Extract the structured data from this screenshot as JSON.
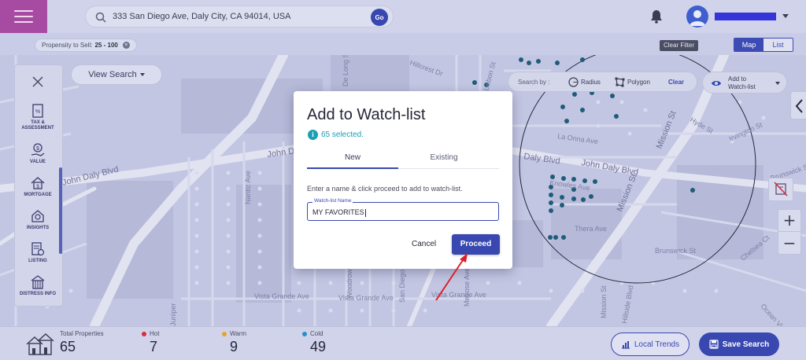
{
  "topbar": {
    "search_value": "333 San Diego Ave, Daly City, CA 94014, USA",
    "go_label": "Go"
  },
  "filters": {
    "chip_label": "Propensity to Sell:",
    "chip_value": "25 - 100",
    "clear_filter": "Clear Filter",
    "view_map": "Map",
    "view_list": "List"
  },
  "sidebar": {
    "items": [
      {
        "label": "TAX &\nASSESSMENT",
        "icon": "tax-assessment-icon"
      },
      {
        "label": "VALUE",
        "icon": "value-icon"
      },
      {
        "label": "MORTGAGE",
        "icon": "mortgage-icon"
      },
      {
        "label": "INSIGHTS",
        "icon": "insights-icon"
      },
      {
        "label": "LISTING",
        "icon": "listing-icon"
      },
      {
        "label": "DISTRESS INFO",
        "icon": "distress-info-icon"
      }
    ]
  },
  "view_search_label": "View Search",
  "searchby": {
    "label": "Search by :",
    "radius": "Radius",
    "polygon": "Polygon",
    "clear": "Clear"
  },
  "watchlist_button": {
    "line1": "Add to",
    "line2": "Watch-list"
  },
  "map": {
    "streets": [
      "John Daly Blvd",
      "John Daly Blvd",
      "Daly Blvd",
      "John Daly Blvd",
      "Mission St",
      "Mission St",
      "Vista Grande Ave",
      "Vista Grande Ave",
      "Vista Grande Ave",
      "Hillcrest Dr",
      "De Long St",
      "Lisbon St",
      "Lisbon St",
      "Knowles Ave",
      "Thera Ave",
      "La Onna Ave",
      "Brunswick St",
      "Brunswick St",
      "Chelsea Ct",
      "Ocean View Ct",
      "Hillside Blvd",
      "Juniper",
      "Melrose Ave",
      "Nantic Ave",
      "Woodrow St",
      "San Diego Ave",
      "Irvington St",
      "Hyde St"
    ]
  },
  "modal": {
    "title": "Add to Watch-list",
    "selected_text": "65 selected.",
    "tab_new": "New",
    "tab_existing": "Existing",
    "instructions": "Enter a name & click proceed to add to watch-list.",
    "field_label": "Watch-list Name",
    "field_value": "MY FAVORITES",
    "cancel": "Cancel",
    "proceed": "Proceed"
  },
  "stats": {
    "total_label": "Total Properties",
    "total_value": "65",
    "hot_label": "Hot",
    "hot_value": "7",
    "hot_color": "#d92b3a",
    "warm_label": "Warm",
    "warm_value": "9",
    "warm_color": "#e3a52a",
    "cold_label": "Cold",
    "cold_value": "49",
    "cold_color": "#2b8fc4"
  },
  "buttons": {
    "local_trends": "Local Trends",
    "save_search": "Save Search"
  },
  "colors": {
    "accent": "#3848b0",
    "hamburger_bg": "#a64aa2",
    "marker": "#1f5c7a"
  }
}
